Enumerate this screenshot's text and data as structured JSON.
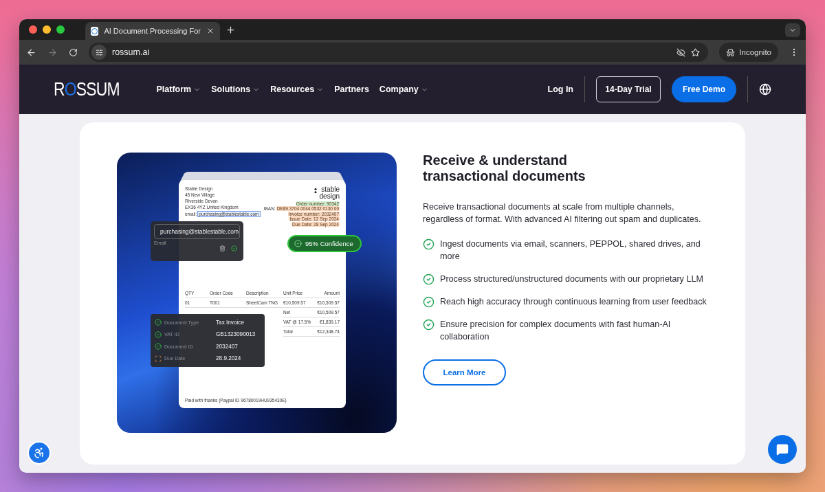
{
  "browser": {
    "tab_title": "AI Document Processing For",
    "url": "rossum.ai",
    "profile": "Incognito"
  },
  "nav": {
    "logo": "ROSSUM",
    "items": [
      {
        "label": "Platform",
        "dropdown": true
      },
      {
        "label": "Solutions",
        "dropdown": true
      },
      {
        "label": "Resources",
        "dropdown": true
      },
      {
        "label": "Partners",
        "dropdown": false
      },
      {
        "label": "Company",
        "dropdown": true
      }
    ],
    "login": "Log In",
    "trial": "14-Day Trial",
    "demo": "Free Demo"
  },
  "illustration": {
    "document": {
      "sender_lines": [
        "Stable Design",
        "45 New Village",
        "Riverside Devon",
        "EX36 4YZ United Kingdom"
      ],
      "email_label": "email:",
      "email_value": "purchasing@stablestable.com",
      "logo_lines": [
        "stable",
        "design"
      ],
      "tags": [
        {
          "text": "Order number: 90342",
          "color": "#cfeecf"
        },
        {
          "label": "IBAN:",
          "text": "DE89 3704 0044 0532 0130 00",
          "color": "#fbd9c0"
        },
        {
          "text": "Invoice number: 2032407",
          "color": "#fbd9c0"
        },
        {
          "text": "Issue Date: 12 Sep 2024",
          "color": "#fbd9c0"
        },
        {
          "text": "Due Date: 28 Sep 2024",
          "color": "#fbd9c0"
        }
      ],
      "columns": [
        "QTY",
        "Order Code",
        "Description",
        "Unit Price",
        "Amount"
      ],
      "rows": [
        [
          "01",
          "T001",
          "SheetCam TNG",
          "€10,509.57",
          "€10,509.57"
        ]
      ],
      "totals": [
        [
          "Net",
          "€10,509.57"
        ],
        [
          "VAT @ 17.5%",
          "€1,839.17"
        ],
        [
          "Total",
          "€12,348.74"
        ]
      ],
      "footer": "Paid with thanks (Paypal ID 96780019HU935430E)"
    },
    "email_popup": {
      "value": "purchasing@stablestable.com",
      "label": "Email"
    },
    "confidence": "95% Confidence",
    "fields": [
      {
        "label": "Document Type",
        "value": "Tax Invoice",
        "verified": true
      },
      {
        "label": "VAT ID",
        "value": "GB1323090013",
        "verified": true
      },
      {
        "label": "Document ID",
        "value": "2032407",
        "verified": true
      },
      {
        "label": "Due Date",
        "value": "28.9.2024",
        "verified": false
      }
    ]
  },
  "section": {
    "heading": "Receive & understand transactional documents",
    "lead": "Receive transactional documents at scale from multiple channels, regardless of format. With advanced AI filtering out spam and duplicates.",
    "features": [
      "Ingest documents via email, scanners, PEPPOL, shared drives, and more",
      "Process structured/unstructured documents with our proprietary LLM",
      "Reach high accuracy through continuous learning from user feedback",
      "Ensure precision for complex documents with fast human-AI collaboration"
    ],
    "button": "Learn More"
  }
}
